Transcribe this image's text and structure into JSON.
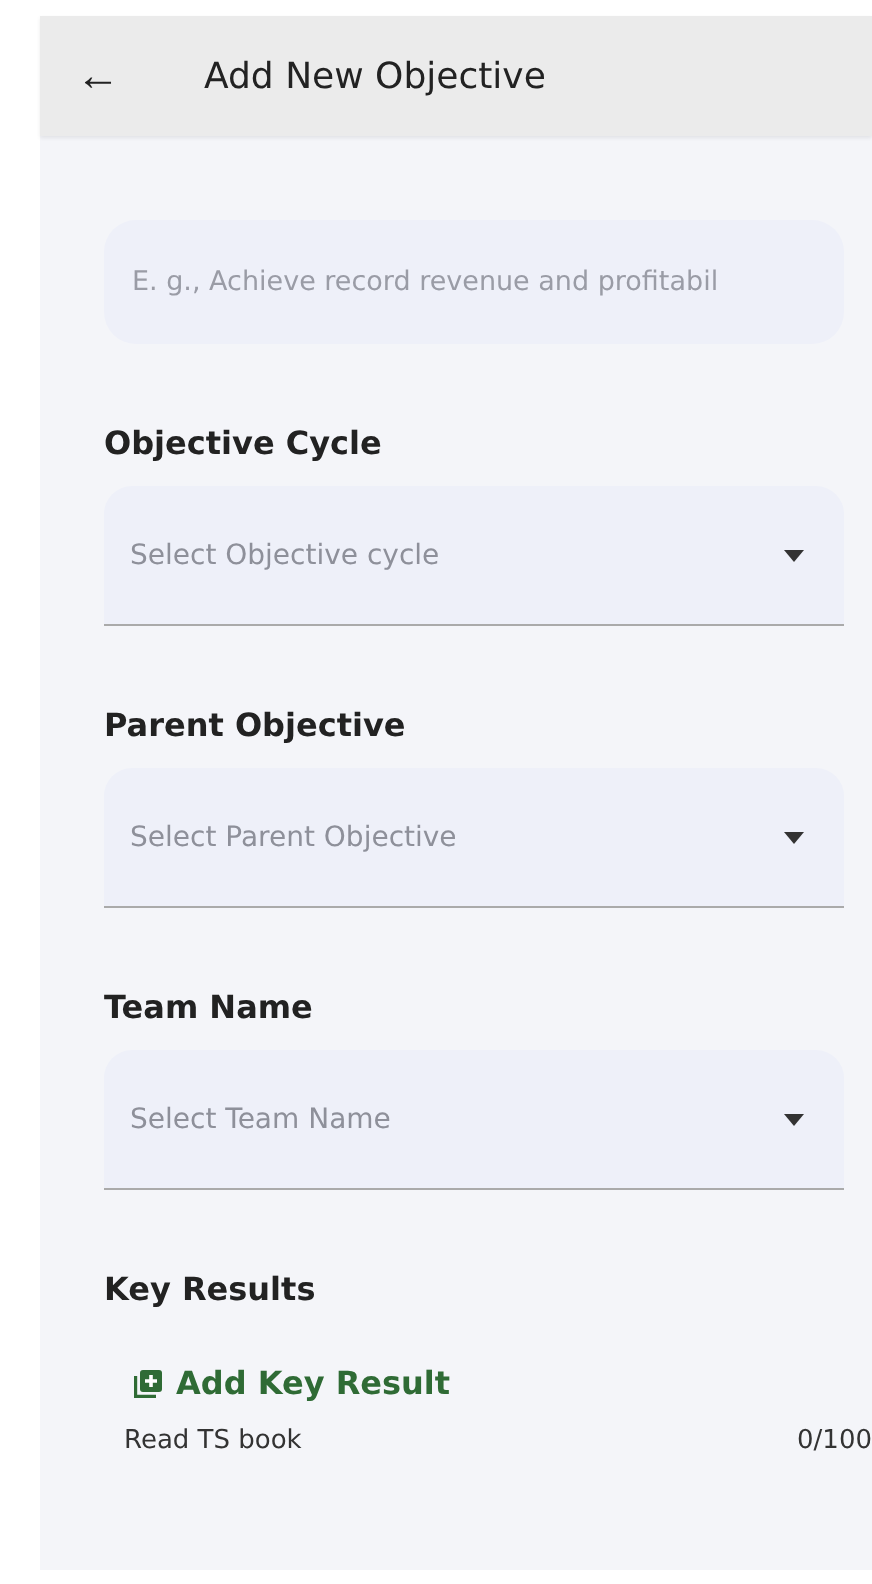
{
  "header": {
    "back": "←",
    "title": "Add New Objective"
  },
  "objective_field": {
    "placeholder": "E. g., Achieve record revenue and profitabil"
  },
  "dropdowns": [
    {
      "label": "Objective Cycle",
      "placeholder": "Select Objective cycle"
    },
    {
      "label": "Parent Objective",
      "placeholder": "Select Parent Objective"
    },
    {
      "label": "Team Name",
      "placeholder": "Select Team Name"
    }
  ],
  "key_results": {
    "label": "Key Results",
    "add_button": "Add Key Result",
    "items": [
      {
        "name": "Read TS book",
        "progress": "0/100"
      }
    ]
  }
}
